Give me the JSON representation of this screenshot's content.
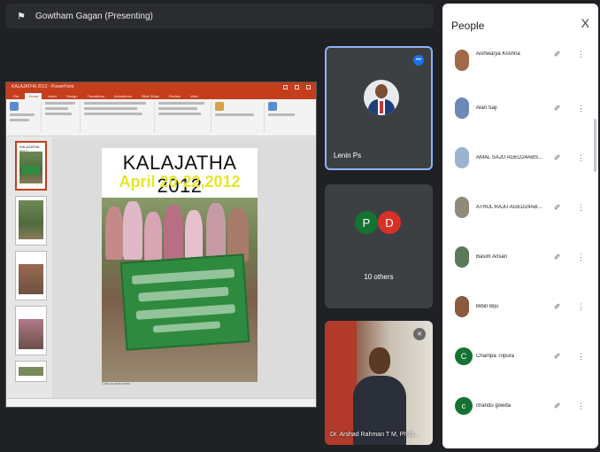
{
  "presenter_bar": {
    "name": "Gowtham Gagan (Presenting)",
    "icon": "pin-icon"
  },
  "slide_window": {
    "title": "KALAJATHA 2012 - PowerPoint",
    "tabs": [
      "File",
      "Home",
      "Insert",
      "Design",
      "Transitions",
      "Animations",
      "Slide Show",
      "Review",
      "View"
    ],
    "active_tab": "Home",
    "slide": {
      "title": "KALAJATHA 2012",
      "subtitle": "April 20-22,2012"
    },
    "thumbnail_label": "KALAJATHA 2012",
    "notes_hint": "Click to add notes"
  },
  "tiles": {
    "lenin": {
      "name": "Lenin Ps"
    },
    "others": {
      "chips": [
        "P",
        "D"
      ],
      "label": "10 others"
    },
    "video": {
      "name": "Dr. Arshad Rahman T M, Ph.D..."
    }
  },
  "people_panel": {
    "title": "People",
    "close_label": "X",
    "participants": [
      {
        "name": "Aishwarya Krishna",
        "avatar_color": "#a06a48"
      },
      {
        "name": "Alan Saji",
        "avatar_color": "#6d89b5"
      },
      {
        "name": "AMAL SAJU AGED24ABS...",
        "avatar_color": "#9bb3cf"
      },
      {
        "name": "ATHUL RAJU AGED24AB...",
        "avatar_color": "#8f8a7a"
      },
      {
        "name": "Basim Ansari",
        "avatar_color": "#5c7a5a"
      },
      {
        "name": "Bibin Biju",
        "avatar_color": "#8a5a3e"
      },
      {
        "name": "Champa Tripura",
        "initial": "C",
        "avatar_color": "#137333"
      },
      {
        "name": "chandu gowda",
        "initial": "c",
        "avatar_color": "#137333"
      }
    ]
  }
}
